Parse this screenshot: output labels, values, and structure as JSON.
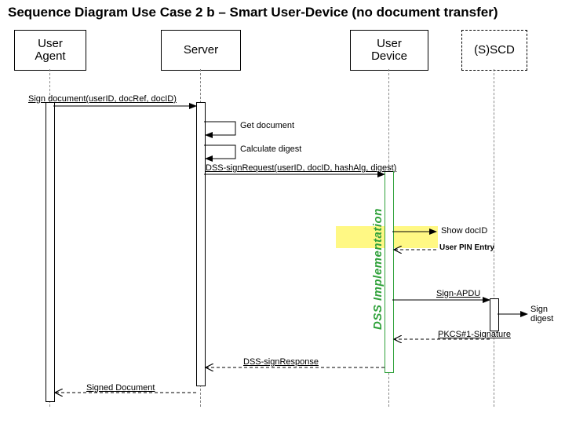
{
  "title": "Sequence Diagram Use Case 2 b – Smart User-Device (no document transfer)",
  "actors": {
    "user_agent": "User\nAgent",
    "server": "Server",
    "user_device": "User\nDevice",
    "sscd": "(S)SCD"
  },
  "messages": {
    "m1": "Sign document(userID, docRef, docID)",
    "m2": "Get document",
    "m3": "Calculate digest",
    "m4": "DSS-signRequest(userID, docID, hashAlg, digest)",
    "m5": "Show docID",
    "m6": "User PIN Entry",
    "m7": "Sign-APDU",
    "m8": "Sign digest",
    "m9": "PKCS#1-Signature",
    "m10": "DSS-signResponse",
    "m11": "Signed Document"
  },
  "dss_label": "DSS Implementation",
  "lifelines_x": {
    "ua": 63,
    "server": 255,
    "ud": 495,
    "sscd": 629
  },
  "colors": {
    "green": "#2fa13a",
    "yellow": "#fff884"
  }
}
